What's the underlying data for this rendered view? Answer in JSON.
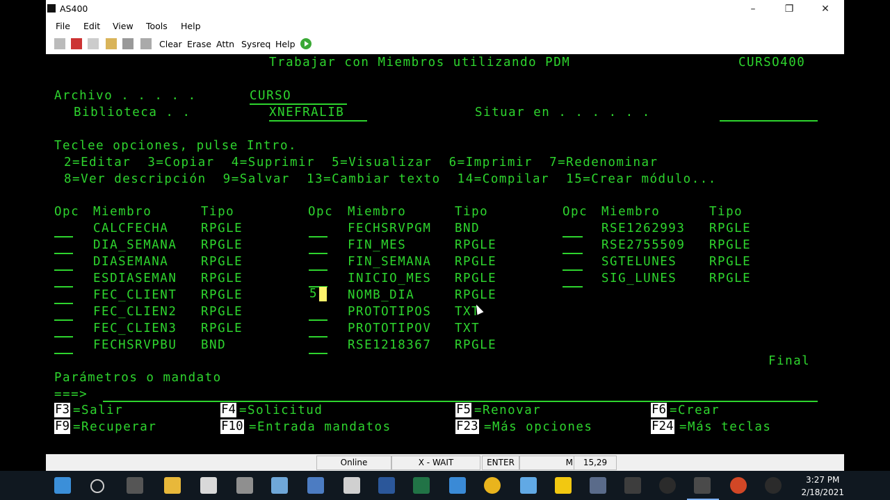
{
  "window": {
    "title": "AS400",
    "minimize": "–",
    "restore": "❐",
    "close": "✕"
  },
  "menu": [
    "File",
    "Edit",
    "View",
    "Tools",
    "Help"
  ],
  "toolbar": {
    "clear": "Clear",
    "erase": "Erase",
    "attn": "Attn",
    "sysreq": "Sysreq",
    "help": "Help"
  },
  "screen": {
    "title": "Trabajar con Miembros utilizando PDM",
    "system": "CURSO400",
    "archivo_label": "Archivo . . . . .",
    "archivo_value": "CURSO",
    "biblioteca_label": "Biblioteca . .",
    "biblioteca_value": "XNEFRALIB",
    "situar_label": "Situar en . . . . . .",
    "instructions": "Teclee opciones, pulse Intro.",
    "options_line1": "2=Editar  3=Copiar  4=Suprimir  5=Visualizar  6=Imprimir  7=Redenominar",
    "options_line2": "8=Ver descripción  9=Salvar  13=Cambiar texto  14=Compilar  15=Crear módulo...",
    "headers": {
      "opc": "Opc",
      "miembro": "Miembro",
      "tipo": "Tipo"
    },
    "columns": [
      [
        {
          "opc": "",
          "miembro": "CALCFECHA",
          "tipo": "RPGLE"
        },
        {
          "opc": "",
          "miembro": "DIA_SEMANA",
          "tipo": "RPGLE"
        },
        {
          "opc": "",
          "miembro": "DIASEMANA",
          "tipo": "RPGLE"
        },
        {
          "opc": "",
          "miembro": "ESDIASEMAN",
          "tipo": "RPGLE"
        },
        {
          "opc": "",
          "miembro": "FEC_CLIENT",
          "tipo": "RPGLE"
        },
        {
          "opc": "",
          "miembro": "FEC_CLIEN2",
          "tipo": "RPGLE"
        },
        {
          "opc": "",
          "miembro": "FEC_CLIEN3",
          "tipo": "RPGLE"
        },
        {
          "opc": "",
          "miembro": "FECHSRVPBU",
          "tipo": "BND"
        }
      ],
      [
        {
          "opc": "",
          "miembro": "FECHSRVPGM",
          "tipo": "BND"
        },
        {
          "opc": "",
          "miembro": "FIN_MES",
          "tipo": "RPGLE"
        },
        {
          "opc": "",
          "miembro": "FIN_SEMANA",
          "tipo": "RPGLE"
        },
        {
          "opc": "",
          "miembro": "INICIO_MES",
          "tipo": "RPGLE"
        },
        {
          "opc": "5",
          "miembro": "NOMB_DIA",
          "tipo": "RPGLE"
        },
        {
          "opc": "",
          "miembro": "PROTOTIPOS",
          "tipo": "TXT"
        },
        {
          "opc": "",
          "miembro": "PROTOTIPOV",
          "tipo": "TXT"
        },
        {
          "opc": "",
          "miembro": "RSE1218367",
          "tipo": "RPGLE"
        }
      ],
      [
        {
          "opc": "",
          "miembro": "RSE1262993",
          "tipo": "RPGLE"
        },
        {
          "opc": "",
          "miembro": "RSE2755509",
          "tipo": "RPGLE"
        },
        {
          "opc": "",
          "miembro": "SGTELUNES",
          "tipo": "RPGLE"
        },
        {
          "opc": "",
          "miembro": "SIG_LUNES",
          "tipo": "RPGLE"
        }
      ]
    ],
    "final": "Final",
    "parametros": "Parámetros o mandato",
    "prompt": "===>",
    "fkeys": [
      {
        "key": "F3",
        "label": "=Salir"
      },
      {
        "key": "F4",
        "label": "=Solicitud"
      },
      {
        "key": "F5",
        "label": "=Renovar"
      },
      {
        "key": "F6",
        "label": "=Crear"
      },
      {
        "key": "F9",
        "label": "=Recuperar"
      },
      {
        "key": "F10",
        "label": "=Entrada mandatos"
      },
      {
        "key": "F23",
        "label": "=Más opciones"
      },
      {
        "key": "F24",
        "label": "=Más teclas"
      }
    ]
  },
  "status": {
    "online": "Online",
    "xwait": "X - WAIT",
    "enter": "ENTER",
    "m": "M",
    "cursor_pos": "15,29"
  },
  "clock": {
    "time": "3:27 PM",
    "date": "2/18/2021"
  }
}
